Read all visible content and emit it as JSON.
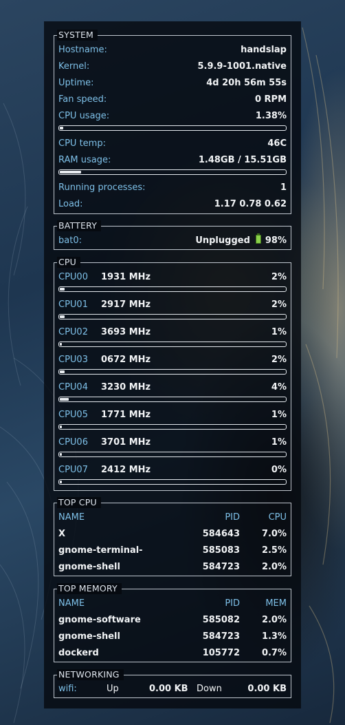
{
  "system": {
    "title": "SYSTEM",
    "hostname_label": "Hostname:",
    "hostname": "handslap",
    "kernel_label": "Kernel:",
    "kernel": "5.9.9-1001.native",
    "uptime_label": "Uptime:",
    "uptime": "4d 20h 56m 55s",
    "fan_label": "Fan speed:",
    "fan": "0 RPM",
    "cpu_usage_label": "CPU usage:",
    "cpu_usage": "1.38%",
    "cpu_usage_fraction": 0.0138,
    "cpu_temp_label": "CPU temp:",
    "cpu_temp": "46C",
    "ram_label": "RAM usage:",
    "ram": "1.48GB / 15.51GB",
    "ram_fraction": 0.095,
    "procs_label": "Running processes:",
    "procs": "1",
    "load_label": "Load:",
    "load": "1.17 0.78 0.62"
  },
  "battery": {
    "title": "BATTERY",
    "name": "bat0:",
    "status": "Unplugged",
    "icon": "battery-icon",
    "level": "98%"
  },
  "cpu": {
    "title": "CPU",
    "cores": [
      {
        "name": "CPU00",
        "freq": "1931 MHz",
        "usage": "2%",
        "fraction": 0.02
      },
      {
        "name": "CPU01",
        "freq": "2917 MHz",
        "usage": "2%",
        "fraction": 0.02
      },
      {
        "name": "CPU02",
        "freq": "3693 MHz",
        "usage": "1%",
        "fraction": 0.01
      },
      {
        "name": "CPU03",
        "freq": "0672 MHz",
        "usage": "2%",
        "fraction": 0.02
      },
      {
        "name": "CPU04",
        "freq": "3230 MHz",
        "usage": "4%",
        "fraction": 0.04
      },
      {
        "name": "CPU05",
        "freq": "1771 MHz",
        "usage": "1%",
        "fraction": 0.01
      },
      {
        "name": "CPU06",
        "freq": "3701 MHz",
        "usage": "1%",
        "fraction": 0.01
      },
      {
        "name": "CPU07",
        "freq": "2412 MHz",
        "usage": "0%",
        "fraction": 0.0
      }
    ]
  },
  "top_cpu": {
    "title": "TOP CPU",
    "headers": {
      "name": "NAME",
      "pid": "PID",
      "value": "CPU"
    },
    "rows": [
      {
        "name": "X",
        "pid": "584643",
        "value": "7.0%"
      },
      {
        "name": "gnome-terminal-",
        "pid": "585083",
        "value": "2.5%"
      },
      {
        "name": "gnome-shell",
        "pid": "584723",
        "value": "2.0%"
      }
    ]
  },
  "top_memory": {
    "title": "TOP MEMORY",
    "headers": {
      "name": "NAME",
      "pid": "PID",
      "value": "MEM"
    },
    "rows": [
      {
        "name": "gnome-software",
        "pid": "585082",
        "value": "2.0%"
      },
      {
        "name": "gnome-shell",
        "pid": "584723",
        "value": "1.3%"
      },
      {
        "name": "dockerd",
        "pid": "105772",
        "value": "0.7%"
      }
    ]
  },
  "networking": {
    "title": "NETWORKING",
    "iface": "wifi:",
    "up_label": "Up",
    "up": "0.00 KB",
    "down_label": "Down",
    "down": "0.00 KB"
  }
}
